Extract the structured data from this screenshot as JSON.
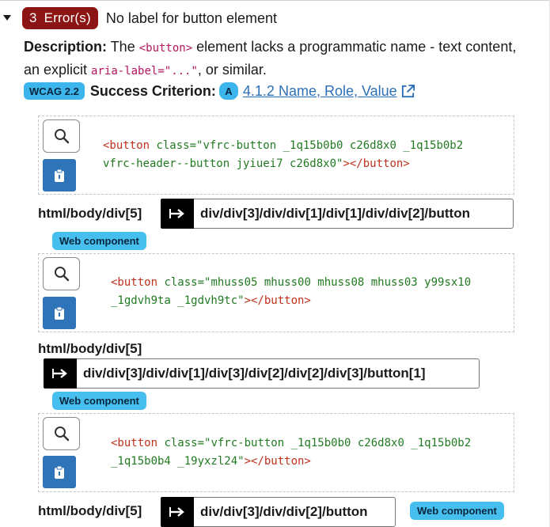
{
  "issue": {
    "error_count": "3",
    "error_suffix": "Error(s)",
    "title": "No label for button element",
    "description_label": "Description:",
    "description_part1": " The ",
    "description_code1": "<button>",
    "description_part2": " element lacks a programmatic name - text content, an explicit ",
    "description_code2": "aria-label=\"...\"",
    "description_part3": ", or similar.",
    "wcag_tag": "WCAG 2.2",
    "success_label": "Success Criterion:",
    "level": "A",
    "criterion_link": "4.1.2 Name, Role, Value"
  },
  "instances": [
    {
      "code_line1_open": "<button ",
      "code_line1_attr": "class=\"vfrc-button _1q15b0b0 c26d8x0 _1q15b0b2",
      "code_line2_attr": "vfrc-header--button jyiuei7 c26d8x0\"",
      "code_line2_close": "></button>",
      "path_prefix": "html/body/div[5]",
      "path_shadow": "div/div[3]/div/div[1]/div[1]/div/div[2]/button",
      "badge": "Web component"
    },
    {
      "code_line1_open": "<button ",
      "code_line1_attr": "class=\"mhuss05 mhuss00 mhuss08 mhuss03 y99sx10",
      "code_line2_attr": "_1gdvh9ta _1gdvh9tc\"",
      "code_line2_close": "></button>",
      "path_prefix": "html/body/div[5]",
      "path_shadow": "div/div[3]/div/div[1]/div[3]/div[2]/div[2]/div[3]/button[1]",
      "badge": "Web component"
    },
    {
      "code_line1_open": "<button ",
      "code_line1_attr": "class=\"vfrc-button _1q15b0b0 c26d8x0 _1q15b0b2",
      "code_line2_attr": "_1q15b0b4 _19yxzl24\"",
      "code_line2_close": "></button>",
      "path_prefix": "html/body/div[5]",
      "path_shadow": "div/div[3]/div/div[2]/button",
      "badge": "Web component"
    }
  ],
  "icons": {
    "caret": "caret-down-icon",
    "external": "external-link-icon",
    "search": "magnifier-icon",
    "copy": "clipboard-icon",
    "shadow": "shadow-dom-arrow-icon"
  },
  "colors": {
    "error_badge": "#8b1515",
    "wcag_badge": "#3bb5ec",
    "web_component_badge": "#47bfee",
    "link": "#2d6fb5",
    "copy_button": "#2f73b9",
    "code_tag": "#c0311c",
    "code_attr": "#227a22"
  }
}
